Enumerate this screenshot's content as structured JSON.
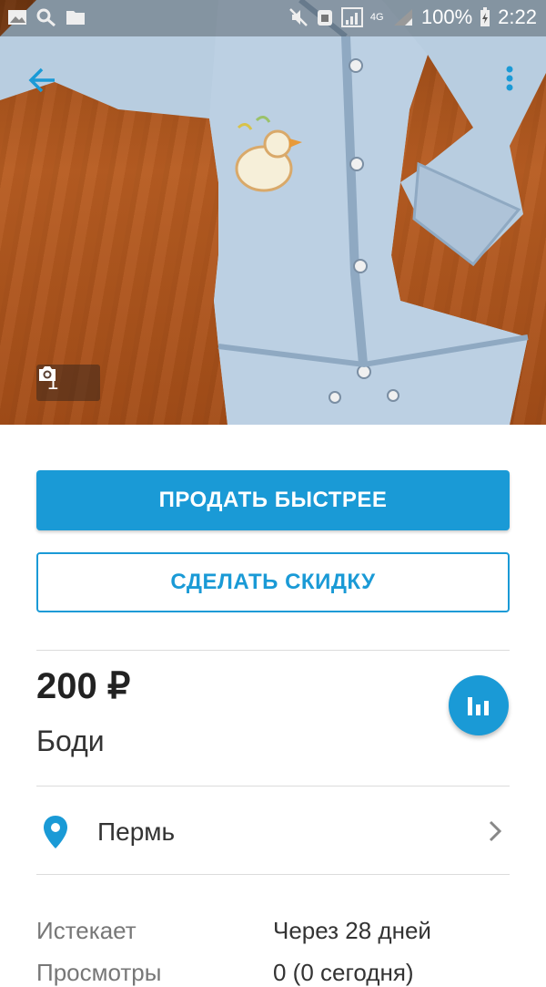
{
  "status_bar": {
    "battery": "100%",
    "time": "2:22",
    "network": "4G"
  },
  "photo": {
    "count": "1",
    "icons": [
      "camera-icon"
    ]
  },
  "actions": {
    "primary_label": "ПРОДАТЬ БЫСТРЕЕ",
    "secondary_label": "СДЕЛАТЬ СКИДКУ"
  },
  "listing": {
    "price": "200 ₽",
    "title": "Боди",
    "location": "Пермь"
  },
  "details": [
    {
      "label": "Истекает",
      "value": "Через 28 дней"
    },
    {
      "label": "Просмотры",
      "value": "0 (0 сегодня)"
    }
  ],
  "colors": {
    "accent": "#1a9ad6",
    "divider": "#dcdcdc"
  }
}
